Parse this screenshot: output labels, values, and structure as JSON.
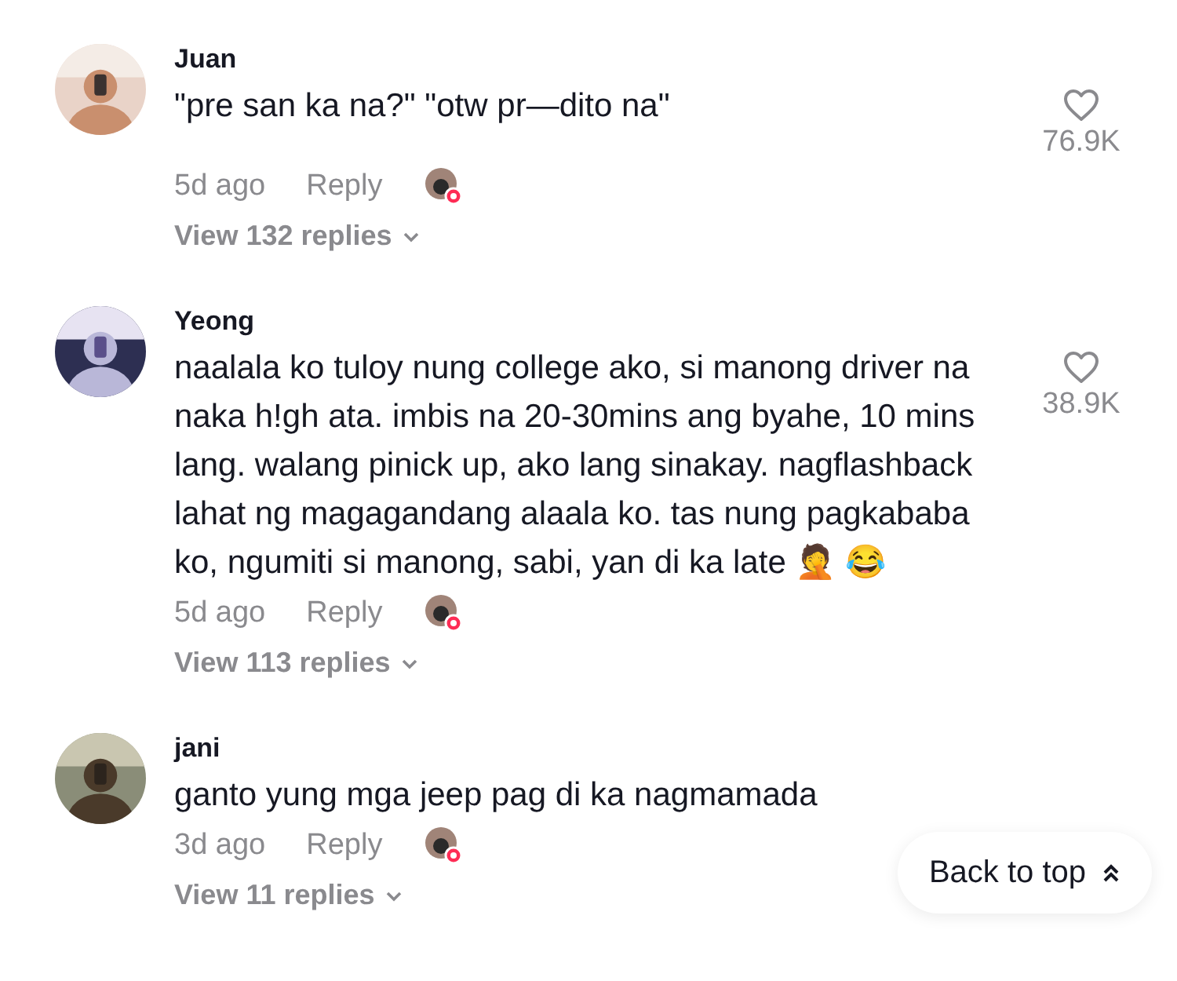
{
  "comments": [
    {
      "author": "Juan",
      "text": "\"pre san ka na?\" \"otw pr—dito na\"",
      "time": "5d ago",
      "reply": "Reply",
      "likes": "76.9K",
      "view_replies": "View 132 replies"
    },
    {
      "author": "Yeong",
      "text": "naalala ko tuloy nung college ako, si manong driver na naka h!gh ata. imbis na 20-30mins ang byahe, 10 mins lang. walang pinick up, ako lang sinakay. nagflashback lahat ng magagandang alaala ko. tas nung pagkababa ko, ngumiti si manong, sabi, yan di ka late 🤦 😂",
      "time": "5d ago",
      "reply": "Reply",
      "likes": "38.9K",
      "view_replies": "View 113 replies"
    },
    {
      "author": "jani",
      "text": "ganto yung mga jeep pag di ka nagmamada",
      "time": "3d ago",
      "reply": "Reply",
      "view_replies": "View 11 replies"
    }
  ],
  "back_to_top": {
    "label": "Back to top"
  }
}
